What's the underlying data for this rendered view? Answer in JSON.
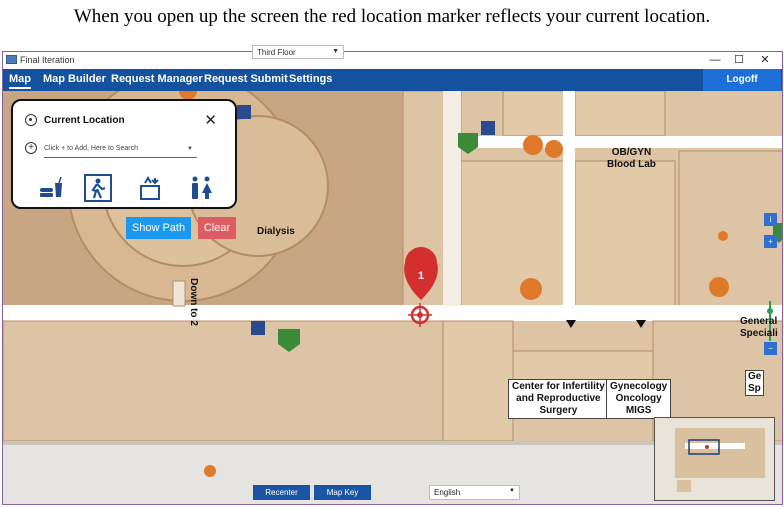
{
  "caption": "When you open up the screen the red location marker reflects your current location.",
  "window": {
    "title": "Final Iteration",
    "controls": {
      "minimize": "—",
      "maximize": "☐",
      "close": "✕"
    }
  },
  "menu": {
    "items": [
      {
        "label": "Map"
      },
      {
        "label": "Map Builder"
      },
      {
        "label": "Request Manager"
      },
      {
        "label": "Request Submit"
      },
      {
        "label": "Settings"
      }
    ],
    "active": "Map",
    "logoff": "Logoff"
  },
  "floor_select": {
    "value": "Third Floor"
  },
  "location_panel": {
    "title": "Current Location",
    "search_placeholder": "Click + to Add, Here to Search",
    "category_icons": [
      "food-icon",
      "exit-icon",
      "elevator-icon",
      "restroom-icon"
    ]
  },
  "buttons": {
    "show_path": "Show Path",
    "clear": "Clear",
    "recenter": "Recenter",
    "map_key": "Map Key"
  },
  "language_select": {
    "value": "English"
  },
  "map_labels": {
    "dialysis": "Dialysis",
    "obgyn": "OB/GYN\nBlood Lab",
    "down_to_2": "Down to 2",
    "infertility": "Center for Infertility\nand Reproductive\nSurgery",
    "gynecology": "Gynecology\nOncology\nMIGS",
    "general_right": "General\nSpeciali",
    "gen_right2": "Ge\nSp"
  },
  "marker": {
    "label": "1"
  },
  "colors": {
    "menubar": "#14529f",
    "logoff": "#1d6ed6",
    "marker": "#d32f2f",
    "show_path": "#1c98ee",
    "clear": "#dd5c63"
  }
}
